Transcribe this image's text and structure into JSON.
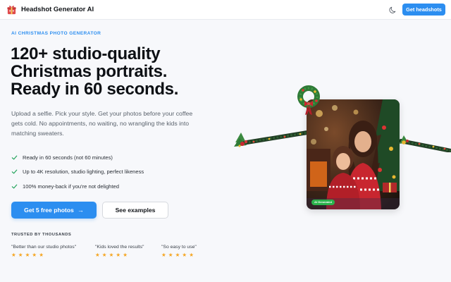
{
  "nav": {
    "brand": "Headshot Generator AI",
    "logo_icon": "gift-box-logo-icon",
    "theme_icon": "moon-icon",
    "cta": "Get headshots"
  },
  "hero": {
    "eyebrow": "AI CHRISTMAS PHOTO GENERATOR",
    "headline": [
      "120+ studio-quality",
      "Christmas portraits.",
      "Ready in 60 seconds."
    ],
    "lede": [
      "Upload a selfie. Pick your style. Get your photos before your coffee",
      "gets cold. No appointments, no waiting, no wrangling the kids into",
      "matching sweaters."
    ],
    "features": [
      "Ready in 60 seconds (not 60 minutes)",
      "Up to 4K resolution, studio lighting, perfect likeness",
      "100% money-back if you're not delighted"
    ],
    "primary_button": "Get 5 free photos",
    "primary_button_icon": "arrow-right-icon",
    "secondary_button": "See examples"
  },
  "trust": {
    "label": "TRUSTED BY THOUSANDS",
    "testimonials": [
      {
        "quote": "\"Better than our studio photos\"",
        "stars": "★ ★ ★ ★ ★"
      },
      {
        "quote": "\"Kids loved the results\"",
        "stars": "★ ★ ★ ★ ★"
      },
      {
        "quote": "\"So easy to use\"",
        "stars": "★ ★ ★ ★ ★"
      }
    ]
  },
  "showcase": {
    "badge": "AI Generated",
    "decor_icons": [
      "christmas-wreath-icon",
      "garland-left-icon",
      "garland-right-icon"
    ]
  },
  "colors": {
    "accent": "#2c8ef0",
    "check": "#22a35a",
    "star": "#f5a623",
    "badge": "#2bb24c"
  }
}
